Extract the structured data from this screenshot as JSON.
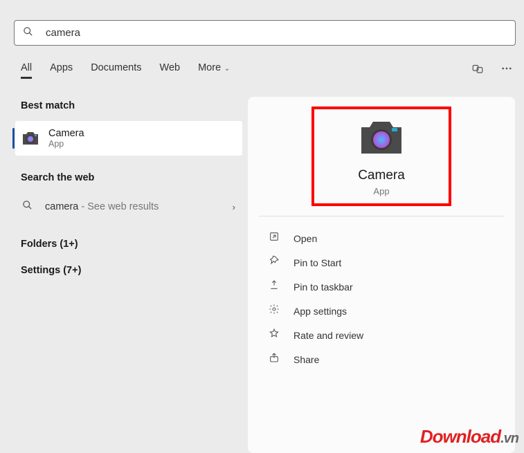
{
  "search": {
    "value": "camera"
  },
  "tabs": {
    "items": [
      {
        "label": "All",
        "active": true
      },
      {
        "label": "Apps",
        "active": false
      },
      {
        "label": "Documents",
        "active": false
      },
      {
        "label": "Web",
        "active": false
      }
    ],
    "more_label": "More"
  },
  "sections": {
    "best_match_label": "Best match",
    "search_web_label": "Search the web",
    "folders_label": "Folders (1+)",
    "settings_label": "Settings (7+)"
  },
  "best_match": {
    "title": "Camera",
    "subtitle": "App"
  },
  "web_result": {
    "term": "camera",
    "suffix": " - See web results"
  },
  "details": {
    "app_name": "Camera",
    "app_type": "App",
    "actions": [
      {
        "icon": "open-icon",
        "label": "Open"
      },
      {
        "icon": "pin-start-icon",
        "label": "Pin to Start"
      },
      {
        "icon": "pin-taskbar-icon",
        "label": "Pin to taskbar"
      },
      {
        "icon": "settings-icon",
        "label": "App settings"
      },
      {
        "icon": "rate-icon",
        "label": "Rate and review"
      },
      {
        "icon": "share-icon",
        "label": "Share"
      }
    ]
  },
  "watermark": {
    "text1": "Download",
    "text2": ".vn"
  }
}
